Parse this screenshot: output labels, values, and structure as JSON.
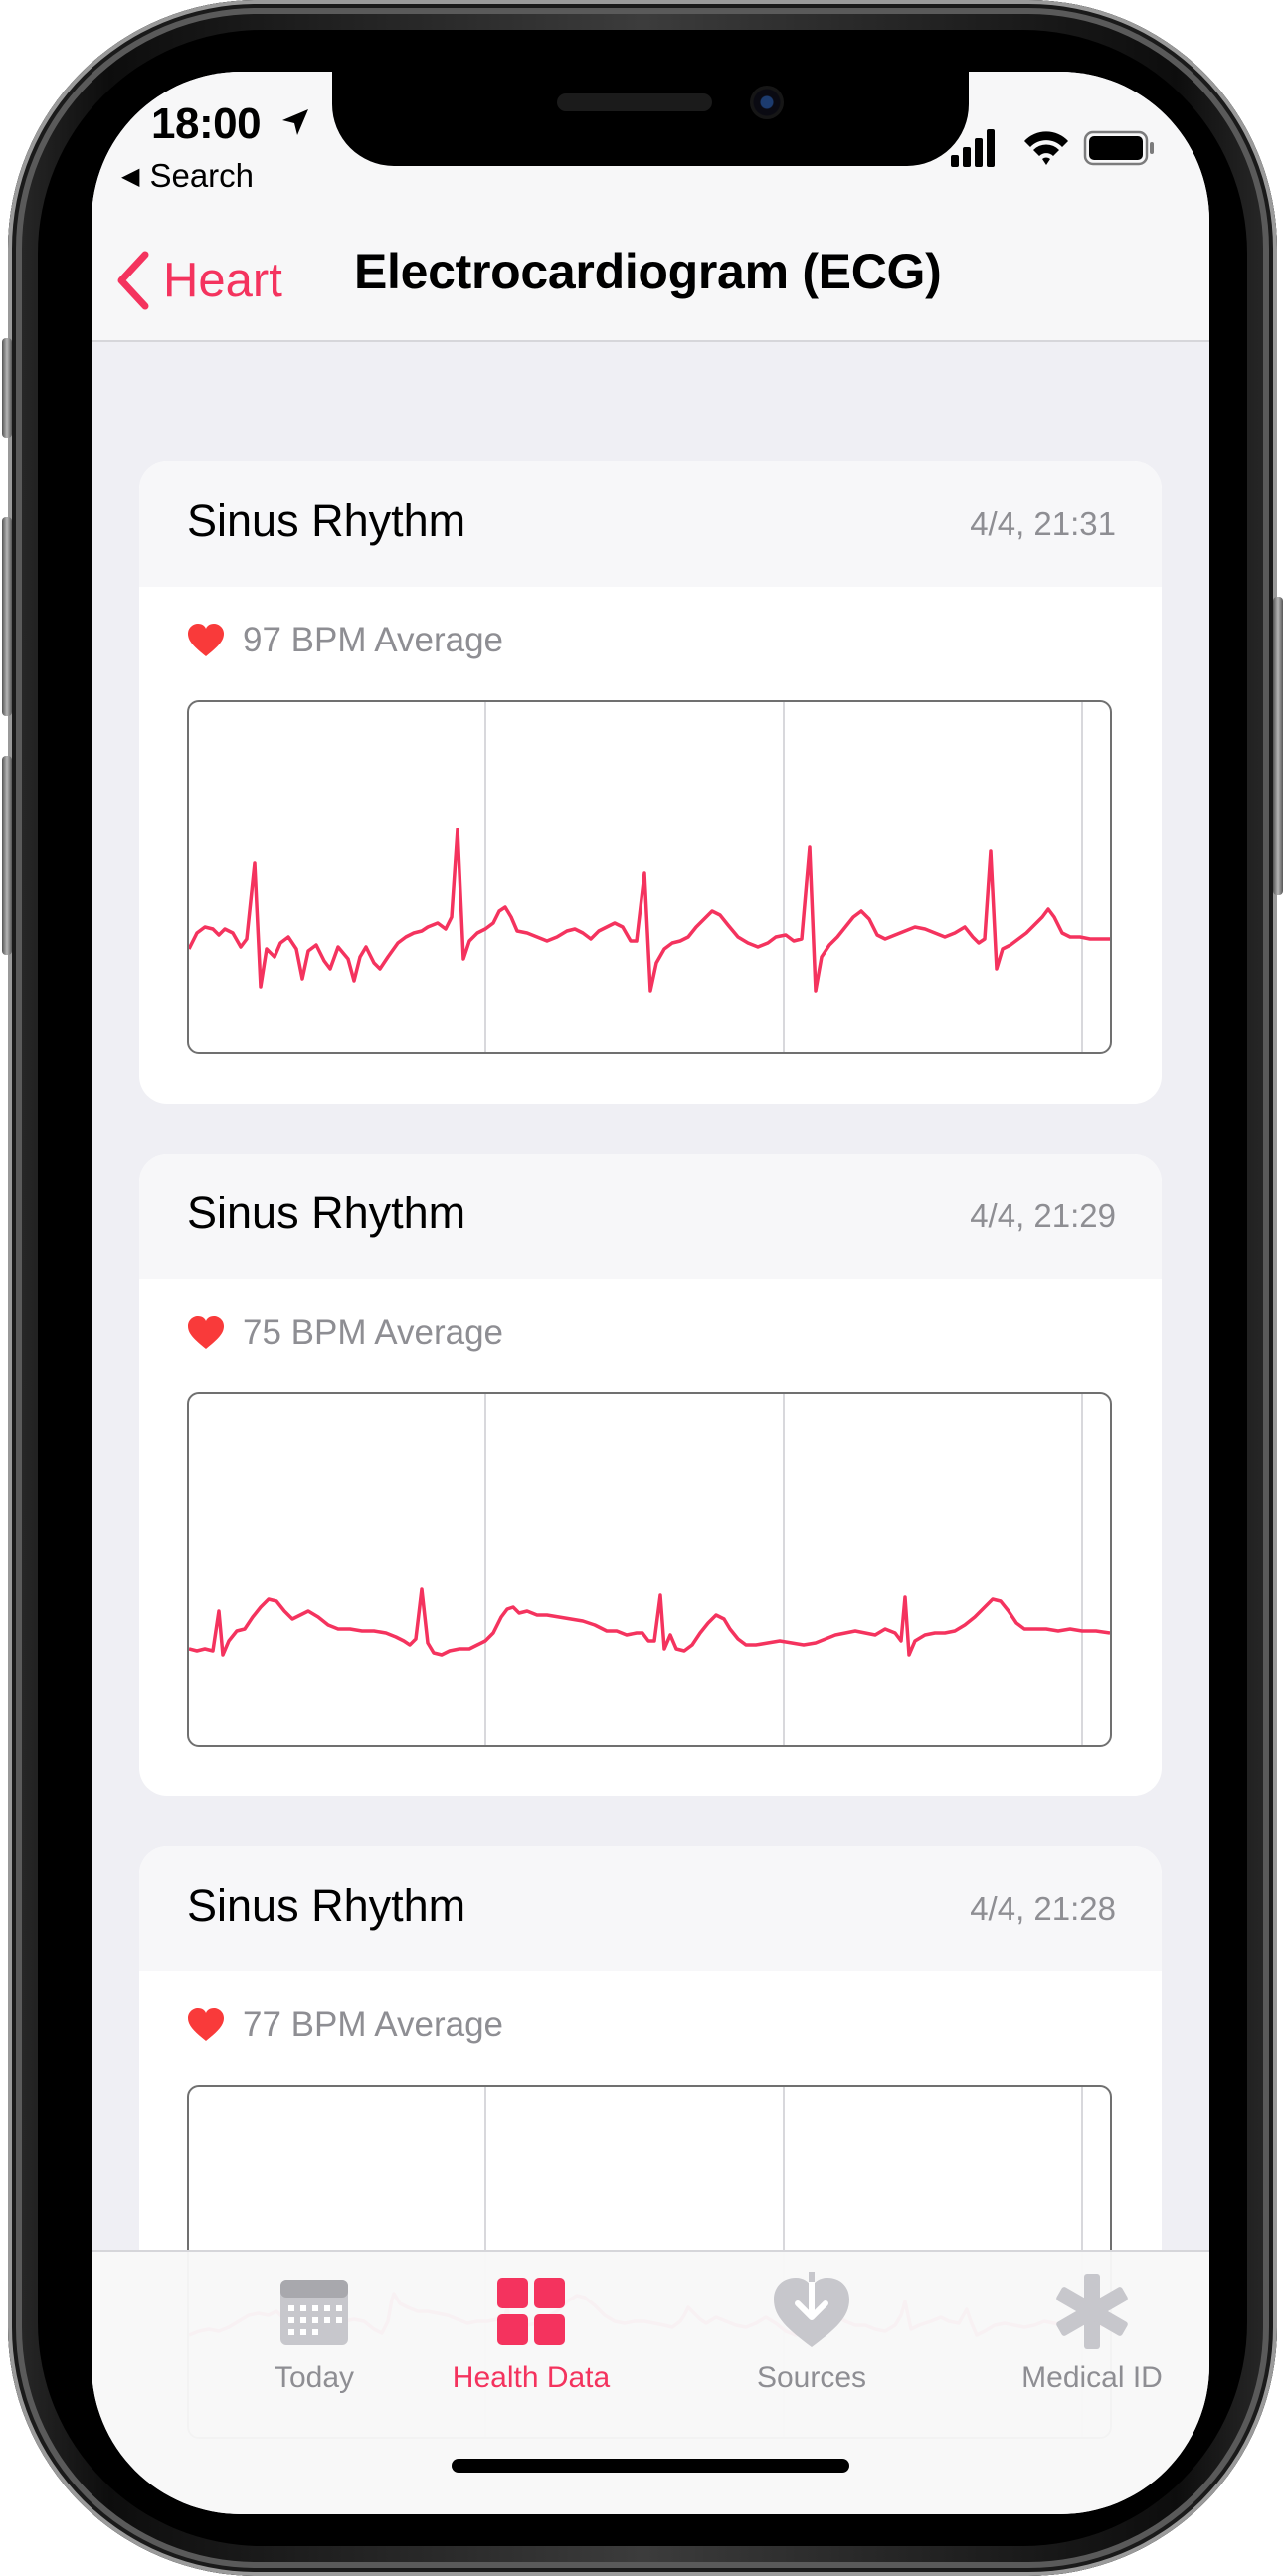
{
  "status_bar": {
    "time": "18:00",
    "back_app": "Search"
  },
  "nav": {
    "back_label": "Heart",
    "title": "Electrocardiogram (ECG)"
  },
  "colors": {
    "accent": "#f4335e",
    "heart": "#f93a3a",
    "secondary_text": "#8e8e93"
  },
  "recordings": [
    {
      "title": "Sinus Rhythm",
      "date": "4/4, 21:31",
      "bpm_text": "97 BPM Average"
    },
    {
      "title": "Sinus Rhythm",
      "date": "4/4, 21:29",
      "bpm_text": "75 BPM Average"
    },
    {
      "title": "Sinus Rhythm",
      "date": "4/4, 21:28",
      "bpm_text": "77 BPM Average"
    }
  ],
  "tabs": [
    {
      "label": "Today",
      "icon": "calendar-icon",
      "active": false
    },
    {
      "label": "Health Data",
      "icon": "grid-icon",
      "active": true
    },
    {
      "label": "Sources",
      "icon": "heart-download-icon",
      "active": false
    },
    {
      "label": "Medical ID",
      "icon": "asterisk-icon",
      "active": false
    }
  ]
}
